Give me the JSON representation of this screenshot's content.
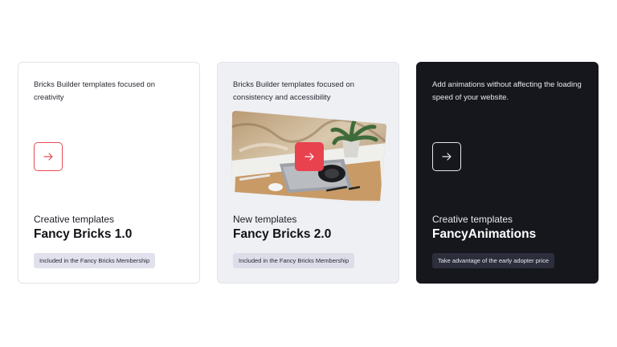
{
  "cards": [
    {
      "description": "Bricks Builder templates focused on creativity",
      "eyebrow": "Creative templates",
      "title": "Fancy Bricks 1.0",
      "badge": "Included in the Fancy Bricks Membership",
      "theme": "light"
    },
    {
      "description": "Bricks Builder templates focused on consistency and accessibility",
      "eyebrow": "New templates",
      "title": "Fancy Bricks 2.0",
      "badge": "Included in the Fancy Bricks Membership",
      "theme": "grey"
    },
    {
      "description": "Add animations without affecting the loading speed of your website.",
      "eyebrow": "Creative templates",
      "title": "FancyAnimations",
      "badge": "Take advantage of the early adopter price",
      "theme": "dark"
    }
  ],
  "icons": {
    "arrow": "arrow-right-icon",
    "photo": "desk-photo-with-plant-laptop-headphones"
  },
  "colors": {
    "accent": "#e9424f",
    "dark_card": "#16171d",
    "grey_card": "#eef0f4"
  }
}
